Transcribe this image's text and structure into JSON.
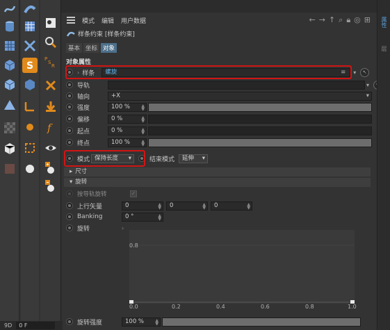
{
  "menu": {
    "items": [
      "模式",
      "编辑",
      "用户数据"
    ]
  },
  "object": {
    "title": "样条约束 [样条约束]"
  },
  "tabs": [
    "基本",
    "坐标",
    "对象"
  ],
  "section": {
    "title": "对象属性"
  },
  "fields": {
    "spline": {
      "label": "样条",
      "value": "螺旋"
    },
    "rail": {
      "label": "导轨"
    },
    "axis": {
      "label": "轴向",
      "value": "+X"
    },
    "strength": {
      "label": "强度",
      "value": "100 %",
      "fraction": 1.0
    },
    "offset": {
      "label": "偏移",
      "value": "0 %",
      "fraction": 0.0
    },
    "start": {
      "label": "起点",
      "value": "0 %",
      "fraction": 0.0
    },
    "end": {
      "label": "终点",
      "value": "100 %",
      "fraction": 1.0
    },
    "mode": {
      "label": "模式",
      "value": "保持长度"
    },
    "end_mode": {
      "label": "结束模式",
      "value": "延伸"
    }
  },
  "groups": {
    "size": "尺寸",
    "rotation": "旋转"
  },
  "rotation": {
    "follow_rail": "按导轨旋转",
    "up_vector": {
      "label": "上行矢量",
      "values": [
        "0",
        "0",
        "0"
      ]
    },
    "banking": {
      "label": "Banking",
      "value": "0 °"
    },
    "rotate": {
      "label": "旋转"
    },
    "graph": {
      "y_label": "0.8",
      "x_ticks": [
        "0.0",
        "0.2",
        "0.4",
        "0.6",
        "0.8",
        "1.0"
      ]
    },
    "strength": {
      "label": "旋转强度",
      "value": "100 %",
      "fraction": 1.0
    }
  },
  "bottom": {
    "frame_label": "9D",
    "frame_value": "0 F"
  },
  "right_strip": {
    "tab1": "属性",
    "tab2": "层"
  },
  "colors": {
    "highlight": "#d21414",
    "accent_blue": "#5aa0d8",
    "spline_value": "#5fb0e8"
  }
}
